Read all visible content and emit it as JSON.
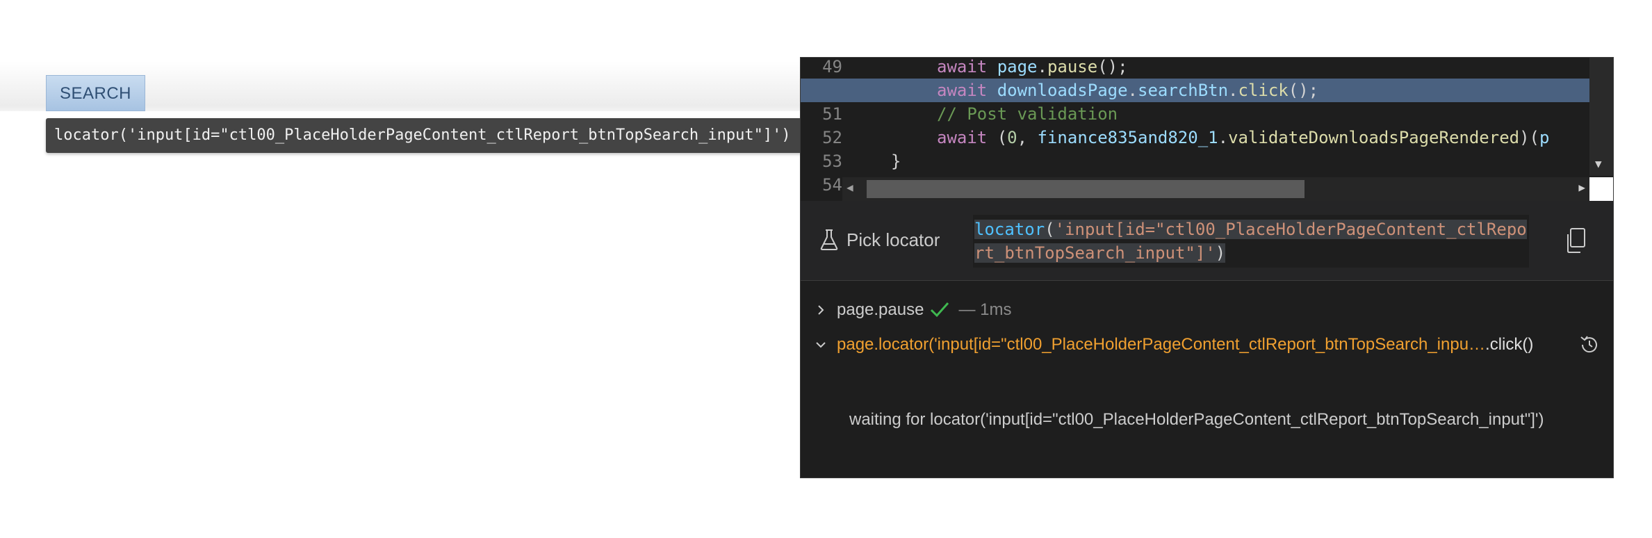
{
  "page": {
    "search_button_label": "SEARCH",
    "tooltip_text": "locator('input[id=\"ctl00_PlaceHolderPageContent_ctlReport_btnTopSearch_input\"]')"
  },
  "editor": {
    "lines": [
      {
        "number": "49",
        "tokens": [
          {
            "t": "await",
            "c": "kw"
          },
          {
            "t": " ",
            "c": "plain"
          },
          {
            "t": "page",
            "c": "var"
          },
          {
            "t": ".",
            "c": "plain"
          },
          {
            "t": "pause",
            "c": "fn"
          },
          {
            "t": "();",
            "c": "plain"
          }
        ]
      },
      {
        "number": "",
        "highlighted": true,
        "tokens": [
          {
            "t": "await",
            "c": "kw"
          },
          {
            "t": " ",
            "c": "plain"
          },
          {
            "t": "downloadsPage",
            "c": "var"
          },
          {
            "t": ".",
            "c": "plain"
          },
          {
            "t": "searchBtn",
            "c": "var"
          },
          {
            "t": ".",
            "c": "plain"
          },
          {
            "t": "click",
            "c": "fn"
          },
          {
            "t": "();",
            "c": "plain"
          }
        ]
      },
      {
        "number": "51",
        "tokens": [
          {
            "t": "// Post validation",
            "c": "cm"
          }
        ]
      },
      {
        "number": "52",
        "tokens": [
          {
            "t": "await",
            "c": "kw"
          },
          {
            "t": " (",
            "c": "plain"
          },
          {
            "t": "0",
            "c": "num"
          },
          {
            "t": ", ",
            "c": "plain"
          },
          {
            "t": "finance835and820_1",
            "c": "var"
          },
          {
            "t": ".",
            "c": "plain"
          },
          {
            "t": "validateDownloadsPageRendered",
            "c": "fn"
          },
          {
            "t": ")(",
            "c": "plain"
          },
          {
            "t": "p",
            "c": "var"
          }
        ]
      },
      {
        "number": "53",
        "tokens": [
          {
            "t": "}",
            "c": "plain"
          }
        ]
      },
      {
        "number": "54",
        "tokens": []
      }
    ]
  },
  "inspector": {
    "pick_locator_label": "Pick locator",
    "locator": {
      "fn": "locator",
      "open": "(",
      "string": "'input[id=\"ctl00_PlaceHolderPageContent_ctlReport_btnTopSearch_input\"]'",
      "close": ")"
    }
  },
  "log": {
    "entries": [
      {
        "expanded": false,
        "name": "page.pause",
        "status": "success",
        "duration": "— 1ms"
      },
      {
        "expanded": true,
        "name": "page.locator('input[id=\"ctl00_PlaceHolderPageContent_ctlReport_btnTopSearch_inpu…",
        "suffix": ".click()",
        "status": "pending"
      }
    ],
    "waiting_text": "waiting for locator('input[id=\"ctl00_PlaceHolderPageContent_ctlReport_btnTopSearch_input\"]')"
  },
  "colors": {
    "accent_orange": "#f0a030",
    "success_green": "#3fb950",
    "highlight_line": "#4a6180",
    "search_button": "#a7c3e2"
  },
  "icons": [
    "flask-icon",
    "copy-icon",
    "chevron-right-icon",
    "chevron-down-icon",
    "check-icon",
    "history-icon"
  ]
}
